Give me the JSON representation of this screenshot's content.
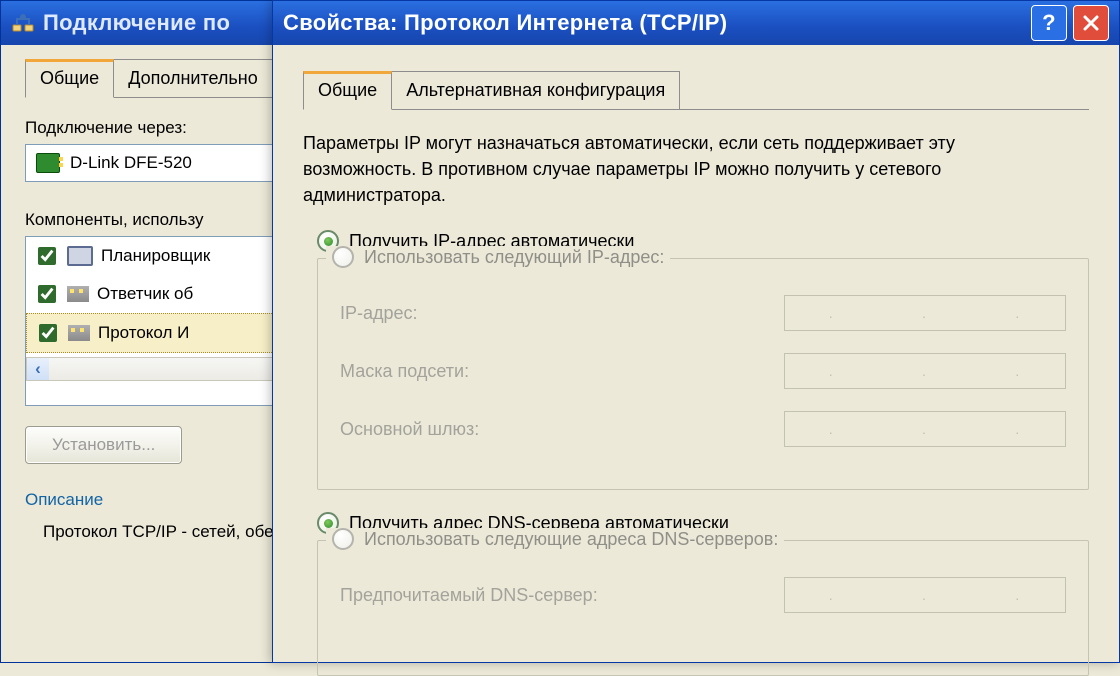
{
  "backWindow": {
    "title": "Подключение по",
    "tabs": {
      "general": "Общие",
      "extra": "Дополнительно"
    },
    "connectThroughLabel": "Подключение через:",
    "adapterName": "D-Link DFE-520",
    "componentsLabel": "Компоненты, использу",
    "items": {
      "scheduler": "Планировщик",
      "responder": "Ответчик об",
      "tcpip": "Протокол И"
    },
    "installButton": "Установить...",
    "descHeading": "Описание",
    "descText": "Протокол TCP/IP - сетей, обеспечива"
  },
  "frontWindow": {
    "title": "Свойства: Протокол Интернета (TCP/IP)",
    "tabs": {
      "general": "Общие",
      "alt": "Альтернативная конфигурация"
    },
    "infoText": "Параметры IP могут назначаться автоматически, если сеть поддерживает эту возможность. В противном случае параметры IP можно получить у сетевого администратора.",
    "ip": {
      "auto": "Получить IP-адрес автоматически",
      "manual": "Использовать следующий IP-адрес:",
      "fields": {
        "address": "IP-адрес:",
        "mask": "Маска подсети:",
        "gateway": "Основной шлюз:"
      }
    },
    "dns": {
      "auto": "Получить адрес DNS-сервера автоматически",
      "manual": "Использовать следующие адреса DNS-серверов:",
      "fields": {
        "preferred": "Предпочитаемый DNS-сервер:"
      }
    }
  }
}
